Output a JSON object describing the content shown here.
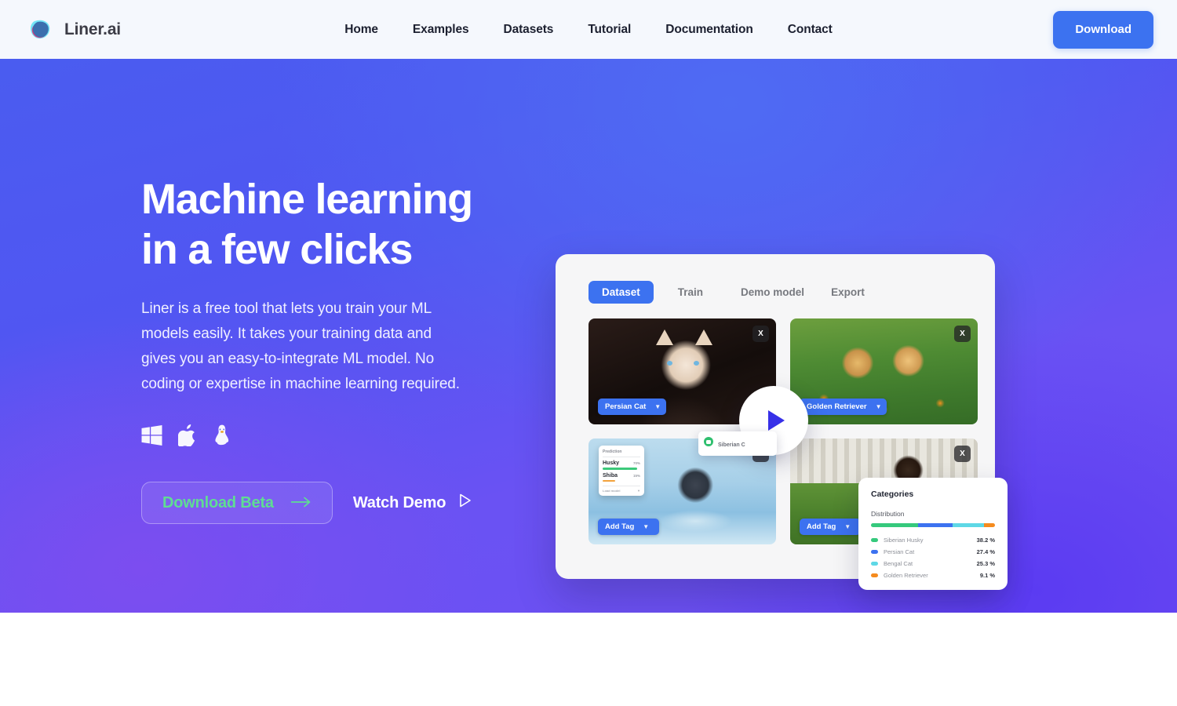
{
  "header": {
    "brand": "Liner.ai",
    "nav": [
      {
        "label": "Home"
      },
      {
        "label": "Examples"
      },
      {
        "label": "Datasets"
      },
      {
        "label": "Tutorial"
      },
      {
        "label": "Documentation"
      },
      {
        "label": "Contact"
      }
    ],
    "download_label": "Download",
    "accent": "#3c72f0"
  },
  "hero": {
    "title_line1": "Machine learning",
    "title_line2": "in a few clicks",
    "subtitle": "Liner is a free tool that lets you train your ML models easily. It takes your training data and gives you an easy-to-integrate ML model. No coding or expertise in machine learning required.",
    "platforms": [
      {
        "name": "windows-icon"
      },
      {
        "name": "apple-icon"
      },
      {
        "name": "linux-icon"
      }
    ],
    "cta_primary": "Download Beta",
    "cta_primary_icon": "arrow-right-icon",
    "cta_primary_color": "#5fdd93",
    "cta_secondary": "Watch Demo",
    "cta_secondary_icon": "play-triangle-icon"
  },
  "app": {
    "tabs": [
      {
        "label": "Dataset",
        "active": true
      },
      {
        "label": "Train",
        "active": false
      },
      {
        "label": "Demo model",
        "active": false
      },
      {
        "label": "Export",
        "active": false
      }
    ],
    "images": [
      {
        "subject": "persian-cat",
        "tag": "Persian Cat",
        "close": "X"
      },
      {
        "subject": "golden-retriever-puppies",
        "tag": "Golden Retriever",
        "close": "X"
      },
      {
        "subject": "siberian-husky",
        "tag": "Add Tag",
        "close": "X"
      },
      {
        "subject": "dachshund-puppy",
        "tag": "Add Tag",
        "close": "X"
      }
    ],
    "prediction": {
      "title": "Prediction",
      "rows": [
        {
          "label": "Husky",
          "pct": "70%",
          "color": "#3cc97a",
          "width": 92
        },
        {
          "label": "Shiba",
          "pct": "15%",
          "color": "#f2a23c",
          "width": 34
        }
      ],
      "footer_left": "Load model",
      "footer_icon": "chevron-down-icon"
    },
    "tag_popup": {
      "text": "Siberian C",
      "icon": "tag-badge-icon"
    },
    "play_button_icon": "play-triangle-icon"
  },
  "categories": {
    "title": "Categories",
    "subtitle": "Distribution",
    "items": [
      {
        "label": "Siberian Husky",
        "value": "38.2 %",
        "pct": 38.2,
        "color": "#35c97c"
      },
      {
        "label": "Persian Cat",
        "value": "27.4 %",
        "pct": 27.4,
        "color": "#3c72f0"
      },
      {
        "label": "Bengal Cat",
        "value": "25.3 %",
        "pct": 25.3,
        "color": "#5ed8e6"
      },
      {
        "label": "Golden Retriever",
        "value": "9.1 %",
        "pct": 9.1,
        "color": "#f58b1e"
      }
    ]
  }
}
